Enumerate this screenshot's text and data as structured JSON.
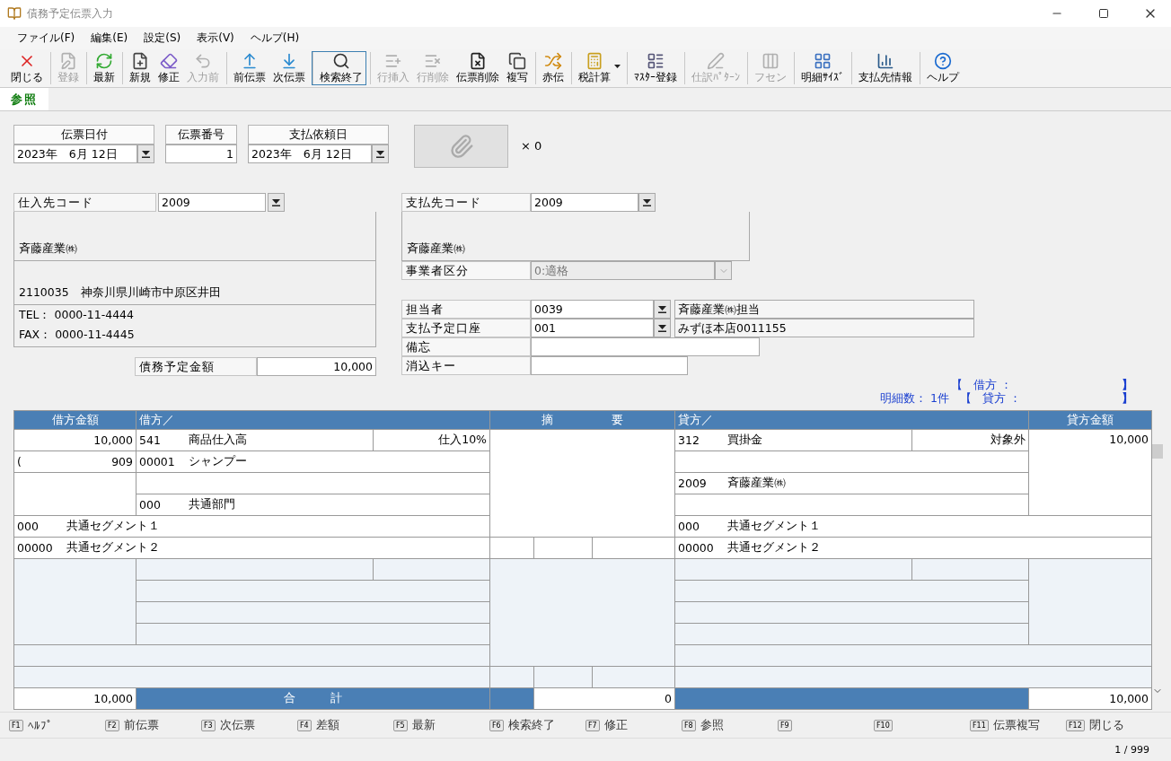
{
  "window": {
    "title": "債務予定伝票入力"
  },
  "menu": [
    "ファイル(F)",
    "編集(E)",
    "設定(S)",
    "表示(V)",
    "ヘルプ(H)"
  ],
  "toolbar": [
    {
      "label": "閉じる",
      "disabled": false,
      "selected": false,
      "group_start": false
    },
    {
      "label": "登録",
      "disabled": true,
      "selected": false,
      "group_start": true
    },
    {
      "label": "最新",
      "disabled": false,
      "selected": false,
      "group_start": true
    },
    {
      "label": "新規",
      "disabled": false,
      "selected": false,
      "group_start": true
    },
    {
      "label": "修正",
      "disabled": false,
      "selected": false,
      "group_start": false
    },
    {
      "label": "入力前",
      "disabled": true,
      "selected": false,
      "group_start": false
    },
    {
      "label": "前伝票",
      "disabled": false,
      "selected": false,
      "group_start": true
    },
    {
      "label": "次伝票",
      "disabled": false,
      "selected": false,
      "group_start": false
    },
    {
      "label": "検索終了",
      "disabled": false,
      "selected": true,
      "group_start": true
    },
    {
      "label": "行挿入",
      "disabled": true,
      "selected": false,
      "group_start": true
    },
    {
      "label": "行削除",
      "disabled": true,
      "selected": false,
      "group_start": false
    },
    {
      "label": "伝票削除",
      "disabled": false,
      "selected": false,
      "group_start": false
    },
    {
      "label": "複写",
      "disabled": false,
      "selected": false,
      "group_start": false
    },
    {
      "label": "赤伝",
      "disabled": false,
      "selected": false,
      "group_start": true
    },
    {
      "label": "税計算",
      "disabled": false,
      "selected": false,
      "group_start": true,
      "dropdown": true
    },
    {
      "label": "ﾏｽﾀｰ登録",
      "disabled": false,
      "selected": false,
      "group_start": true
    },
    {
      "label": "仕訳ﾊﾟﾀｰﾝ",
      "disabled": true,
      "selected": false,
      "group_start": true
    },
    {
      "label": "フセン",
      "disabled": true,
      "selected": false,
      "group_start": true
    },
    {
      "label": "明細ｻｲｽﾞ",
      "disabled": false,
      "selected": false,
      "group_start": true
    },
    {
      "label": "支払先情報",
      "disabled": false,
      "selected": false,
      "group_start": true
    },
    {
      "label": "ヘルプ",
      "disabled": false,
      "selected": false,
      "group_start": true
    }
  ],
  "tabs": [
    {
      "label": "参照",
      "selected": true
    }
  ],
  "header": {
    "date": {
      "label": "伝票日付",
      "value": "2023年　6月 12日"
    },
    "number": {
      "label": "伝票番号",
      "value": "1"
    },
    "request_date": {
      "label": "支払依頼日",
      "value": "2023年　6月 12日"
    },
    "attachments": "× 0"
  },
  "supplier": {
    "code_label": "仕入先コード",
    "code": "2009",
    "name": "斉藤産業㈱",
    "address": "2110035　神奈川県川崎市中原区井田",
    "tel": "TEL： 0000-11-4444",
    "fax": "FAX： 0000-11-4445",
    "amount_label": "債務予定金額",
    "amount": "10,000"
  },
  "payee": {
    "code_label": "支払先コード",
    "code": "2009",
    "name": "斉藤産業㈱",
    "business_label": "事業者区分",
    "business": "0:適格",
    "business_disabled": true,
    "staff_label": "担当者",
    "staff_code": "0039",
    "staff_name": "斉藤産業㈱担当",
    "account_label": "支払予定口座",
    "account_code": "001",
    "account_name": "みずほ本店0011155",
    "memo_label": "備忘",
    "clear_key_label": "消込キー"
  },
  "summary": {
    "count": "明細数： 1件",
    "lines": [
      {
        "open": "【",
        "label": "借方 ：",
        "close": "】"
      },
      {
        "open": "【",
        "label": "貸方 ：",
        "close": "】"
      }
    ]
  },
  "journal": {
    "headers": [
      "借方金額",
      "借方／",
      "摘　　　　　要",
      "貸方／",
      "貸方金額"
    ],
    "debit": {
      "amount": "10,000",
      "tax_open": "(",
      "tax_amount": "909",
      "account_code": "541",
      "account_name": "商品仕入高",
      "tax_type": "仕入10%",
      "item_code": "00001",
      "item_name": "シャンプー",
      "dept_code": "000",
      "dept_name": "共通部門",
      "segment1_code": "000",
      "segment1_name": "共通セグメント１",
      "segment2_code": "00000",
      "segment2_name": "共通セグメント２"
    },
    "credit": {
      "account_code": "312",
      "account_name": "買掛金",
      "tax_type": "対象外",
      "amount": "10,000",
      "partner_code": "2009",
      "partner_name": "斉藤産業㈱",
      "segment1_code": "000",
      "segment1_name": "共通セグメント１",
      "segment2_code": "00000",
      "segment2_name": "共通セグメント２"
    },
    "total": {
      "debit": "10,000",
      "label": "合　　　計",
      "summary": "0",
      "credit": "10,000"
    }
  },
  "function_keys": [
    {
      "key": "F1",
      "label": "ﾍﾙﾌﾟ"
    },
    {
      "key": "F2",
      "label": "前伝票"
    },
    {
      "key": "F3",
      "label": "次伝票"
    },
    {
      "key": "F4",
      "label": "差額"
    },
    {
      "key": "F5",
      "label": "最新"
    },
    {
      "key": "F6",
      "label": "検索終了"
    },
    {
      "key": "F7",
      "label": "修正"
    },
    {
      "key": "F8",
      "label": "参照"
    },
    {
      "key": "F9"
    },
    {
      "key": "F10"
    },
    {
      "key": "F11",
      "label": "伝票複写"
    },
    {
      "key": "F12",
      "label": "閉じる"
    }
  ],
  "status_bar": {
    "page": "1 / 999"
  }
}
